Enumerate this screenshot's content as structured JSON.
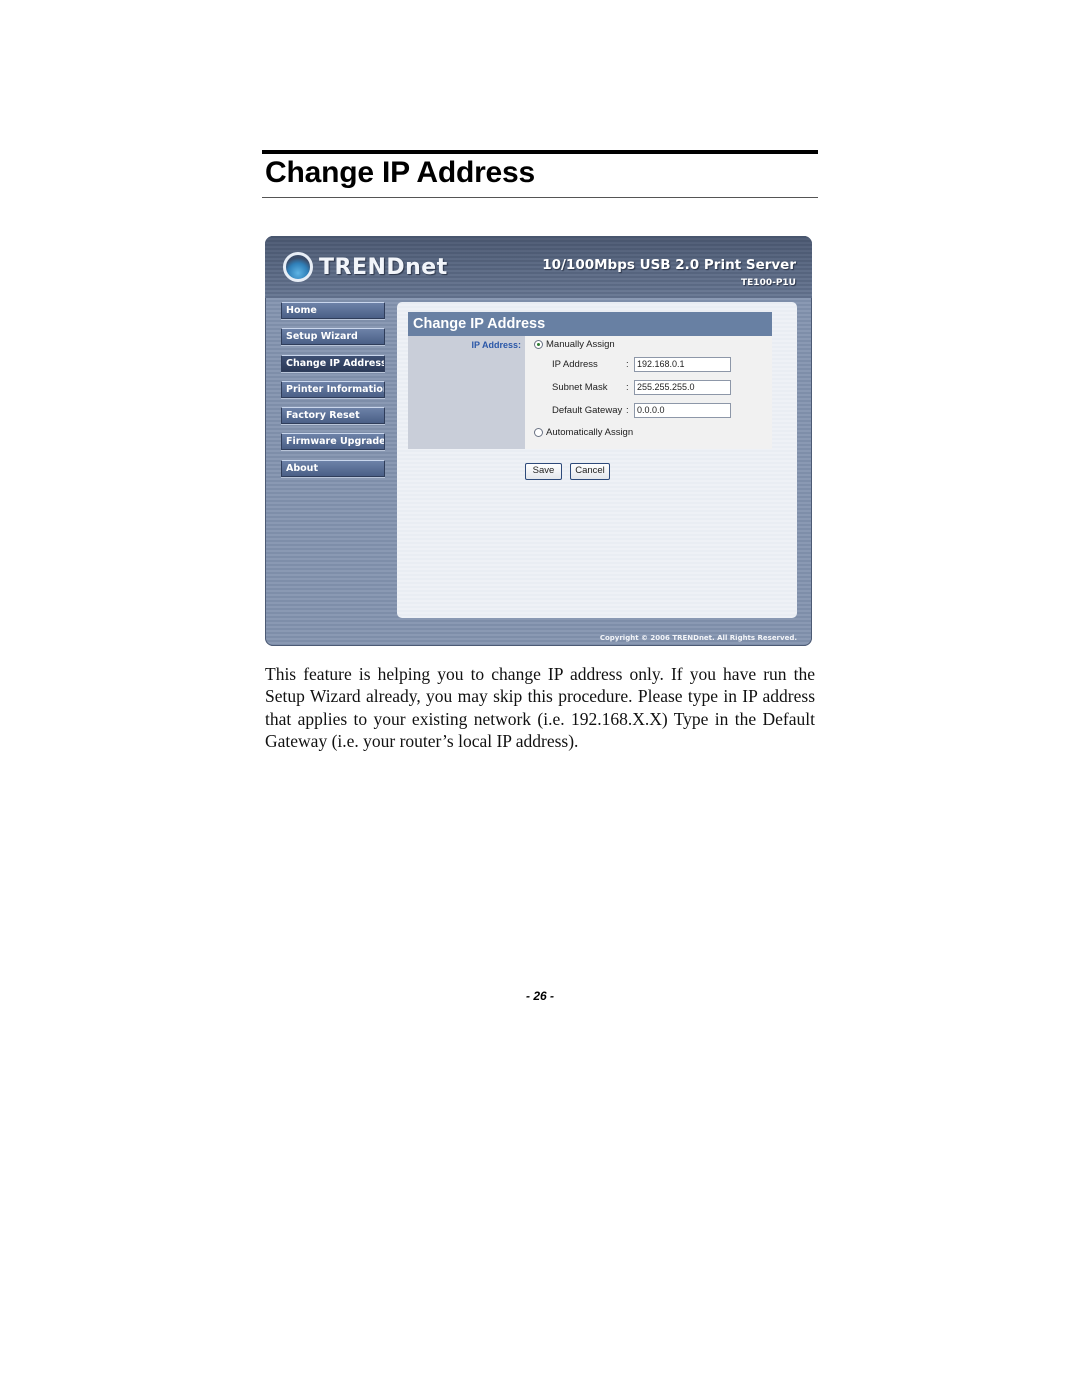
{
  "document": {
    "title": "Change IP Address",
    "body": "This feature is helping you to change IP address only.  If you have run the Setup Wizard already, you may skip this procedure. Please type in IP address that applies to your existing network (i.e. 192.168.X.X) Type in the Default Gateway (i.e. your router’s local IP address).",
    "page_number": "- 26 -"
  },
  "screenshot": {
    "brand": "TRENDnet",
    "product_title": "10/100Mbps USB 2.0 Print Server",
    "product_model": "TE100-P1U",
    "nav": [
      {
        "label": "Home",
        "active": false
      },
      {
        "label": "Setup Wizard",
        "active": false
      },
      {
        "label": "Change IP Address",
        "active": true
      },
      {
        "label": "Printer Information",
        "active": false
      },
      {
        "label": "Factory Reset",
        "active": false
      },
      {
        "label": "Firmware Upgrade",
        "active": false
      },
      {
        "label": "About",
        "active": false
      }
    ],
    "panel_title": "Change IP Address",
    "section_label": "IP Address:",
    "manual_option": "Manually Assign",
    "auto_option": "Automatically Assign",
    "selected_option": "Manually Assign",
    "fields": [
      {
        "label": "IP Address",
        "value": "192.168.0.1"
      },
      {
        "label": "Subnet Mask",
        "value": "255.255.255.0"
      },
      {
        "label": "Default Gateway",
        "value": "0.0.0.0"
      }
    ],
    "colon": ":",
    "save_label": "Save",
    "cancel_label": "Cancel",
    "copyright": "Copyright © 2006 TRENDnet. All Rights Reserved.",
    "colors": {
      "panel_header": "#6880a3",
      "section_label": "#2a57a8",
      "frame": "#7e8ea9"
    }
  }
}
